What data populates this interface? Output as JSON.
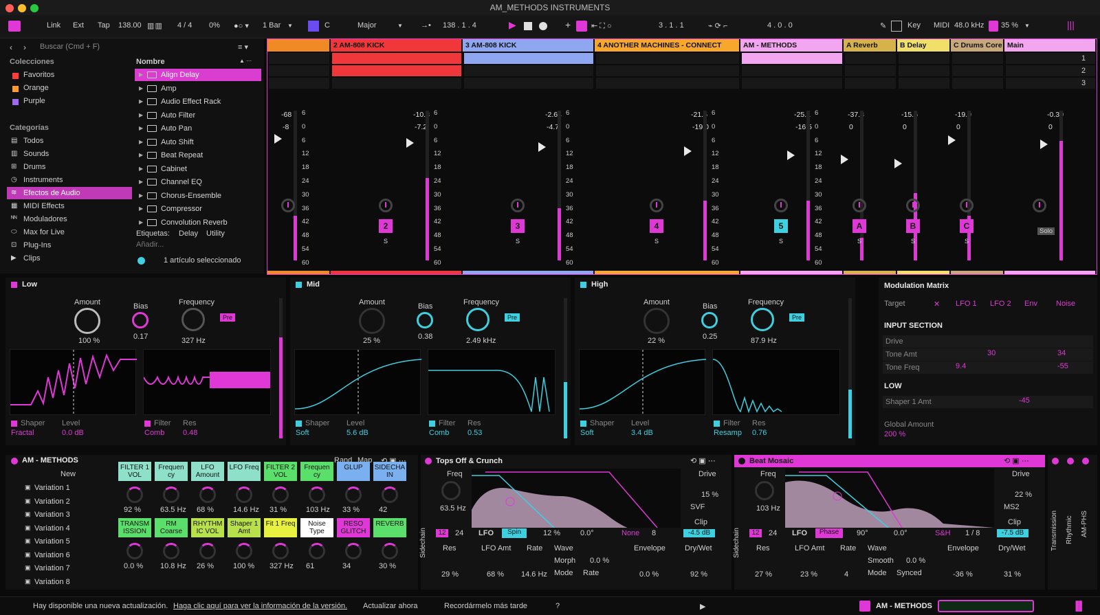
{
  "window": {
    "title": "AM_METHODS INSTRUMENTS"
  },
  "transport": {
    "link": "Link",
    "ext": "Ext",
    "tap": "Tap",
    "tempo": "138.00",
    "signature": "4 / 4",
    "cpu": "0%",
    "quantize": "1 Bar",
    "key_root": "C",
    "scale": "Major",
    "position": "138 .  1 .  4",
    "loop_start": "3 .  1 .  1",
    "loop_length": "4 .  0 .  0",
    "key_label": "Key",
    "midi_label": "MIDI",
    "sample_rate": "48.0 kHz",
    "zoom": "35 %"
  },
  "browser": {
    "search_placeholder": "Buscar (Cmd + F)",
    "collections_title": "Colecciones",
    "collections": [
      "Favoritos",
      "Orange",
      "Purple"
    ],
    "categories_title": "Categorías",
    "categories": [
      "Todos",
      "Sounds",
      "Drums",
      "Instruments",
      "Efectos de Audio",
      "MIDI Effects",
      "Moduladores",
      "Max for Live",
      "Plug-Ins",
      "Clips"
    ],
    "name_header": "Nombre",
    "items": [
      "Align Delay",
      "Amp",
      "Audio Effect Rack",
      "Auto Filter",
      "Auto Pan",
      "Auto Shift",
      "Beat Repeat",
      "Cabinet",
      "Channel EQ",
      "Chorus-Ensemble",
      "Compressor",
      "Convolution Reverb"
    ],
    "tags_label": "Etiquetas:",
    "tag1": "Delay",
    "tag2": "Utility",
    "add_label": "Añadir...",
    "status": "1 artículo seleccionado"
  },
  "mixer": {
    "tracks": [
      {
        "name": "",
        "color": "#f08a24",
        "vol": "-68",
        "peak": "-8",
        "num": "",
        "meter": 0.3
      },
      {
        "name": "2 AM-808 KICK",
        "color": "#f0383a",
        "vol": "-10.3",
        "peak": "-7.2",
        "num": "2",
        "meter": 0.55
      },
      {
        "name": "3 AM-808 KICK",
        "color": "#8fa6f0",
        "vol": "-2.64",
        "peak": "-4.7",
        "num": "3",
        "meter": 0.35
      },
      {
        "name": "4 ANOTHER MACHINES - CONNECT",
        "color": "#f6a72c",
        "vol": "-21.5",
        "peak": "-19.0",
        "num": "4",
        "meter": 0.4
      },
      {
        "name": "AM - METHODS",
        "color": "#f2a6f0",
        "vol": "-25.1",
        "peak": "-16.5",
        "num": "5",
        "meter": 0.4
      },
      {
        "name": "A Reverb",
        "color": "#d6b24a",
        "vol": "-37.8",
        "peak": "0",
        "num": "A",
        "meter": 0.15
      },
      {
        "name": "B Delay",
        "color": "#f0e06a",
        "vol": "-15.6",
        "peak": "0",
        "num": "B",
        "meter": 0.45
      },
      {
        "name": "C Drums Core",
        "color": "#c7a87a",
        "vol": "-19.9",
        "peak": "0",
        "num": "C",
        "meter": 0.3
      },
      {
        "name": "Main",
        "color": "#f2a6f0",
        "vol": "-0.30",
        "peak": "0",
        "num": "",
        "meter": 0.8
      }
    ],
    "scale": [
      "6",
      "0",
      "6",
      "12",
      "18",
      "24",
      "30",
      "36",
      "42",
      "48",
      "54",
      "60"
    ],
    "scene_numbers": [
      "1",
      "2",
      "3"
    ],
    "solo_label": "Solo",
    "s_label": "S"
  },
  "bands": [
    {
      "title": "Low",
      "amount": "100 %",
      "bias": "0.17",
      "freq": "327 Hz",
      "shaper": "Fractal",
      "level": "0.0 dB",
      "filter": "Comb",
      "res": "0.48",
      "color": "#e038d6"
    },
    {
      "title": "Mid",
      "amount": "25 %",
      "bias": "0.38",
      "freq": "2.49 kHz",
      "shaper": "Soft",
      "level": "5.6 dB",
      "filter": "Comb",
      "res": "0.53",
      "color": "#3ed0e0"
    },
    {
      "title": "High",
      "amount": "22 %",
      "bias": "0.25",
      "freq": "87.9 Hz",
      "shaper": "Soft",
      "level": "3.4 dB",
      "filter": "Resamp",
      "res": "0.76",
      "color": "#3ed0e0"
    }
  ],
  "labels": {
    "amount": "Amount",
    "bias": "Bias",
    "frequency": "Frequency",
    "pre": "Pre",
    "shaper": "Shaper",
    "level": "Level",
    "filter": "Filter",
    "res": "Res"
  },
  "modmatrix": {
    "title": "Modulation Matrix",
    "target": "Target",
    "sources": [
      "LFO 1",
      "LFO 2",
      "Env",
      "Noise"
    ],
    "input_section": "INPUT SECTION",
    "rows": [
      {
        "name": "Drive",
        "v1": "",
        "v2": ""
      },
      {
        "name": "Tone Amt",
        "v1": "30",
        "v2": "34"
      },
      {
        "name": "Tone Freq",
        "v1": "9.4",
        "v2": "-55"
      }
    ],
    "low_title": "LOW",
    "low_row": {
      "name": "Shaper 1 Amt",
      "v": "-45"
    },
    "global_label": "Global Amount",
    "global_value": "200 %"
  },
  "rack": {
    "title": "AM - METHODS",
    "rand": "Rand",
    "map": "Map",
    "new": "New",
    "variations": [
      "Variation 1",
      "Variation 2",
      "Variation 3",
      "Variation 4",
      "Variation 5",
      "Variation 6",
      "Variation 7",
      "Variation 8"
    ],
    "macros_row1": [
      {
        "label": "FILTER 1 VOL",
        "value": "92 %",
        "color": "#8ee0c8"
      },
      {
        "label": "Frequen cy",
        "value": "63.5 Hz",
        "color": "#8ee0c8"
      },
      {
        "label": "LFO Amount",
        "value": "68 %",
        "color": "#8ee0c8"
      },
      {
        "label": "LFO Freq",
        "value": "14.6 Hz",
        "color": "#8ee0c8"
      },
      {
        "label": "FILTER 2 VOL",
        "value": "31 %",
        "color": "#5ae06a"
      },
      {
        "label": "Frequen cy",
        "value": "103 Hz",
        "color": "#5ae06a"
      },
      {
        "label": "GLUP",
        "value": "33 %",
        "color": "#7ab0f0"
      },
      {
        "label": "SIDECHA IN",
        "value": "42",
        "color": "#7ab0f0"
      }
    ],
    "macros_row2": [
      {
        "label": "TRANSM ISSION",
        "value": "0.0 %",
        "color": "#5ae06a"
      },
      {
        "label": "RM Coarse",
        "value": "10.8 Hz",
        "color": "#5ae06a"
      },
      {
        "label": "RHYTHM IC VOL",
        "value": "26 %",
        "color": "#b8e04a"
      },
      {
        "label": "Shaper 1 Amt",
        "value": "100 %",
        "color": "#b8e04a"
      },
      {
        "label": "Fit 1 Freq",
        "value": "327 Hz",
        "color": "#e8f040"
      },
      {
        "label": "Noise Type",
        "value": "61",
        "color": "#ffffff"
      },
      {
        "label": "RESO GLITCH",
        "value": "34",
        "color": "#e038d6"
      },
      {
        "label": "REVERB",
        "value": "30 %",
        "color": "#5ae06a"
      }
    ]
  },
  "device1": {
    "title": "Tops Off & Crunch",
    "freq_label": "Freq",
    "freq": "63.5 Hz",
    "drive_label": "Drive",
    "drive": "15 %",
    "mode": "SVF",
    "clip_label": "Clip",
    "clip": "-4.5 dB",
    "slope1": "12",
    "slope2": "24",
    "lfo": "LFO",
    "spin": "Spin",
    "lfo_pct": "12 %",
    "phase": "0.0°",
    "none": "None",
    "div": "8",
    "res_label": "Res",
    "res": "29 %",
    "lfoamt_label": "LFO Amt",
    "lfoamt": "68 %",
    "rate_label": "Rate",
    "rate": "14.6 Hz",
    "wave_label": "Wave",
    "morph_label": "Morph",
    "morph": "0.0 %",
    "mode_label": "Mode",
    "mode_val": "Rate",
    "env_label": "Envelope",
    "env": "0.0 %",
    "drywet_label": "Dry/Wet",
    "drywet": "92 %",
    "sidechain": "Sidechain"
  },
  "device2": {
    "title": "Beat Mosaic",
    "freq_label": "Freq",
    "freq": "103 Hz",
    "drive_label": "Drive",
    "drive": "22 %",
    "mode": "MS2",
    "clip_label": "Clip",
    "clip": "-7.5 dB",
    "slope1": "12",
    "slope2": "24",
    "lfo": "LFO",
    "phase_btn": "Phase",
    "phase": "90°",
    "phase2": "0.0°",
    "sh": "S&H",
    "div": "1 / 8",
    "res_label": "Res",
    "res": "27 %",
    "lfoamt_label": "LFO Amt",
    "lfoamt": "23 %",
    "rate_label": "Rate",
    "rate": "4",
    "wave_label": "Wave",
    "smooth_label": "Smooth",
    "smooth": "0.0 %",
    "mode_label": "Mode",
    "mode_val": "Synced",
    "env_label": "Envelope",
    "env": "-36 %",
    "drywet_label": "Dry/Wet",
    "drywet": "31 %",
    "sidechain": "Sidechain"
  },
  "side_labels": [
    "Transmission",
    "Rhythmic",
    "AM-PHS"
  ],
  "status": {
    "message": "Hay disponible una nueva actualización.",
    "link": "Haga clic aquí para ver la información de la versión.",
    "update": "Actualizar ahora",
    "remind": "Recordármelo más tarde",
    "help": "?",
    "track": "AM - METHODS"
  }
}
